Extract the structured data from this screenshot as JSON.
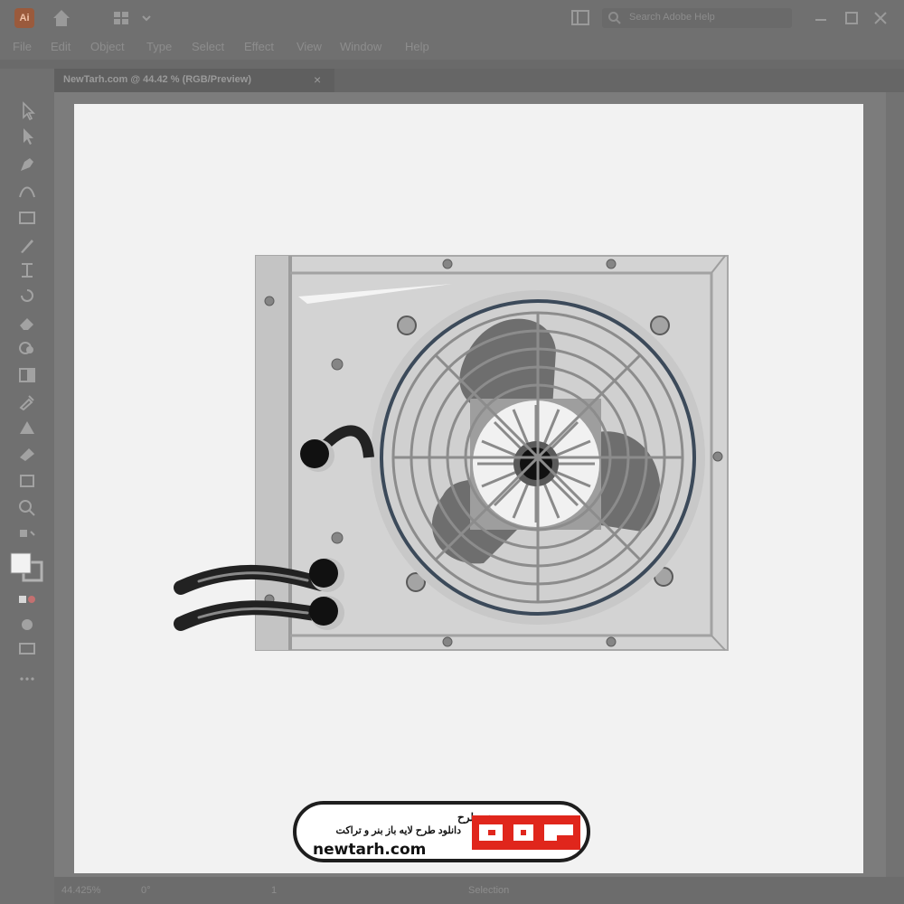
{
  "app": {
    "logo_text": "Ai"
  },
  "search": {
    "placeholder": "Search Adobe Help"
  },
  "menu": [
    "File",
    "Edit",
    "Object",
    "Type",
    "Select",
    "Effect",
    "View",
    "Window",
    "Help"
  ],
  "document_tab": {
    "label": "NewTarh.com @ 44.42 % (RGB/Preview)",
    "close": "×"
  },
  "status": {
    "zoom": "44.425%",
    "angle": "0°",
    "page": "1",
    "tool": "Selection"
  },
  "watermark": {
    "name": "نیوطرح",
    "tagline": "دانلود طرح لایه باز بنر و تراکت",
    "url": "newtarh.com",
    "logo_text": "نیوطرح",
    "brand_color": "#e0261c"
  },
  "colors": {
    "chrome": "#707070",
    "artboard": "#f2f2f2",
    "panel": "#d6d6d6",
    "grille": "#3c4a5a"
  }
}
